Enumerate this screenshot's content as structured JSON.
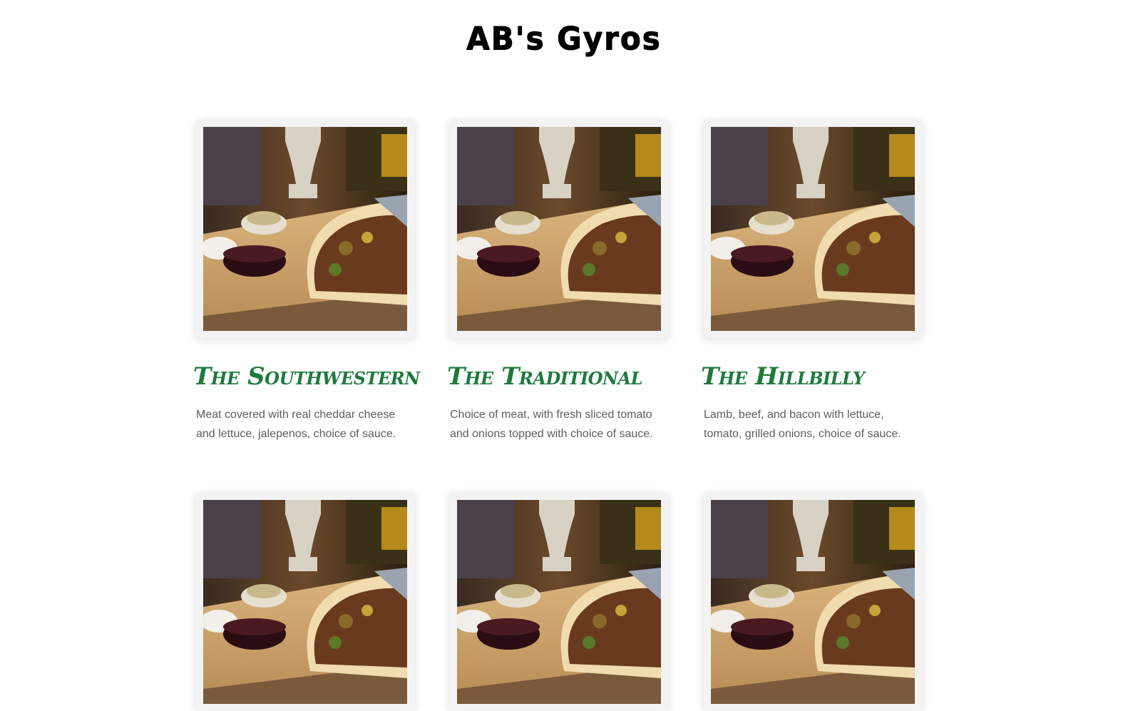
{
  "site": {
    "title": "AB's Gyros"
  },
  "menu": [
    {
      "title": "The Southwestern",
      "description": "Meat covered with real cheddar cheese and lettuce, jalepenos, choice of sauce.",
      "image": "gyro-photo"
    },
    {
      "title": "The Traditional",
      "description": "Choice of meat, with fresh sliced tomato and onions topped with choice of sauce.",
      "image": "gyro-photo"
    },
    {
      "title": "The Hillbilly",
      "description": "Lamb, beef, and bacon with lettuce, tomato, grilled onions, choice of sauce.",
      "image": "gyro-photo"
    },
    {
      "image": "gyro-photo"
    },
    {
      "image": "gyro-photo"
    },
    {
      "image": "gyro-photo"
    }
  ],
  "colors": {
    "accent": "#1e7a3c",
    "text": "#5e5e5e",
    "frame": "#f3f3f3"
  }
}
